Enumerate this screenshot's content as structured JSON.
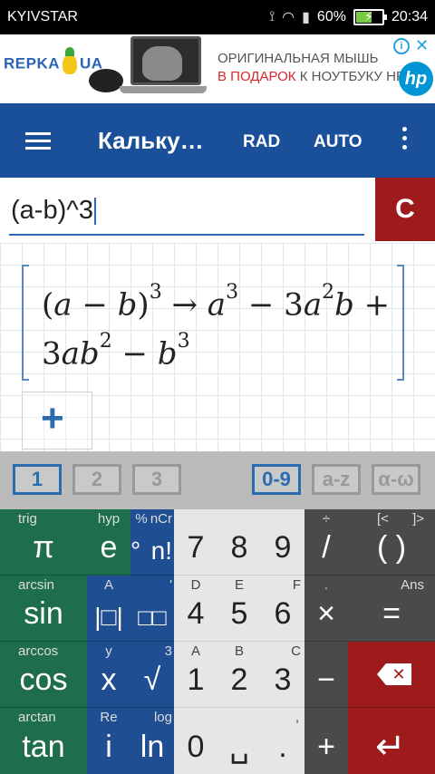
{
  "status": {
    "carrier": "KYIVSTAR",
    "battery": "60%",
    "battery_level": 0.6,
    "time": "20:34"
  },
  "ad": {
    "logo": "REPKA",
    "logo2": "UA",
    "line1": "ОРИГИНАЛЬНАЯ МЫШЬ",
    "line2_red": "В ПОДАРОК",
    "line2_rest": " К НОУТБУКУ HP!",
    "brand": "hp",
    "info": "i",
    "close": "✕"
  },
  "appbar": {
    "title": "Кальку…",
    "angle_mode": "RAD",
    "eval_mode": "AUTO"
  },
  "input": {
    "value": "(a-b)^3",
    "clear_label": "C"
  },
  "result": {
    "expression": "(a − b)^3",
    "output": "a^3 − 3a^2b + 3ab^2 − b^3"
  },
  "add_button": "+",
  "kb_tabs": [
    "1",
    "2",
    "3",
    "0-9",
    "a-z",
    "α-ω"
  ],
  "kb_active": [
    "1",
    "0-9"
  ],
  "keys": {
    "col1": [
      {
        "sub": "trig",
        "main": "π"
      },
      {
        "sub": "arcsin",
        "main": "sin"
      },
      {
        "sub": "arccos",
        "main": "cos"
      },
      {
        "sub": "arctan",
        "main": "tan"
      }
    ],
    "col2a": [
      {
        "sub": "hyp",
        "main": "e"
      },
      {
        "sub": "A",
        "main": "|□|"
      },
      {
        "sub": "y",
        "main": "x"
      },
      {
        "sub": "Re",
        "main": "i"
      }
    ],
    "col2b": [
      {
        "sub": "%",
        "main": "°"
      },
      {
        "sub": "",
        "main": "□□"
      },
      {
        "sub": "",
        "main": "√"
      },
      {
        "sub": "log",
        "main": "ln"
      }
    ],
    "col2c": [
      {
        "sub": "nCr",
        "main": "n!"
      },
      {
        "sub": "'",
        "main": ""
      },
      {
        "sub": "3",
        "main": ""
      },
      {
        "sub": "",
        "main": ""
      }
    ],
    "digits": [
      [
        {
          "sub": "",
          "main": "7"
        },
        {
          "sub": "",
          "main": "8"
        },
        {
          "sub": "",
          "main": "9"
        }
      ],
      [
        {
          "sub": "D",
          "main": "4"
        },
        {
          "sub": "E",
          "main": "5"
        },
        {
          "sub": "F",
          "main": "6"
        }
      ],
      [
        {
          "sub": "A",
          "main": "1"
        },
        {
          "sub": "B",
          "main": "2"
        },
        {
          "sub": "C",
          "main": "3"
        }
      ],
      [
        {
          "sub": "",
          "main": "0"
        },
        {
          "sub": "",
          "main": "␣"
        },
        {
          "sub": ",",
          "main": "."
        }
      ]
    ],
    "ops": [
      {
        "sub": "÷",
        "main": "/"
      },
      {
        "sub": ".",
        "main": "×"
      },
      {
        "sub": "",
        "main": "−"
      },
      {
        "sub": "",
        "main": "+"
      }
    ],
    "right": [
      {
        "sub_l": "[<",
        "sub_r": "]>",
        "main": "(  )"
      },
      {
        "sub_r": "Ans",
        "main": "="
      }
    ]
  },
  "colors": {
    "appbar": "#1a4f9a",
    "accent": "#2b6cb0",
    "clear": "#9e1b1b",
    "green_keys": "#1e6e4e",
    "blue_keys": "#1f4e92"
  }
}
